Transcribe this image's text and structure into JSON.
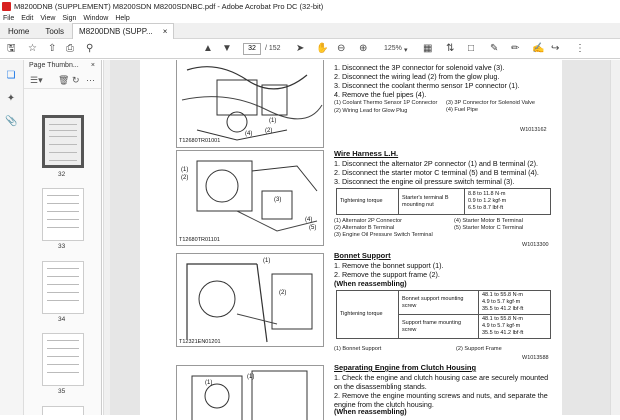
{
  "window": {
    "title": "M8200DNB (SUPPLEMENT) M8200SDN M8200SDNBC.pdf - Adobe Acrobat Pro DC (32-bit)"
  },
  "menu": [
    "File",
    "Edit",
    "View",
    "Sign",
    "Window",
    "Help"
  ],
  "tabs": [
    {
      "label": "Home"
    },
    {
      "label": "Tools"
    },
    {
      "label": "M8200DNB (SUPP...",
      "close": "×"
    }
  ],
  "toolbar": {
    "current_page": "32",
    "total_pages": "/ 152",
    "zoom": "125%"
  },
  "thumb_panel": {
    "title": "Page Thumbn...",
    "close": "×",
    "pages": [
      "32",
      "33",
      "34",
      "35"
    ]
  },
  "doc": {
    "sec0": {
      "steps": [
        "1.  Disconnect the 3P connector for solenoid valve (3).",
        "2.  Disconnect the wiring lead (2) from the glow plug.",
        "3.  Disconnect the coolant thermo sensor 1P connector (1).",
        "4.  Remove the fuel pipes (4)."
      ],
      "legend": [
        "(1)  Coolant Thermo Sensor 1P Connector",
        "(2)  Wiring Lead for Glow Plug",
        "(3)  3P Connector for Solenoid Valve",
        "(4)  Fuel Pipe"
      ],
      "code": "W1013162",
      "fig_caption": "T12680TR01001"
    },
    "sec1": {
      "heading": "Wire Harness L.H.",
      "steps": [
        "1.  Disconnect the alternator 2P connector (1) and B terminal (2).",
        "2.  Disconnect the starter motor C terminal (5) and B terminal (4).",
        "3.  Disconnect the engine oil pressure switch terminal (3)."
      ],
      "torque_label": "Tightening torque",
      "torque_item": "Starter's terminal B mounting nut",
      "torque_values": "8.8 to 11.8 N·m\n0.9 to 1.2 kgf·m\n6.5 to 8.7 lbf·ft",
      "legend": [
        "(1)  Alternator 2P Connector",
        "(2)  Alternator B Terminal",
        "(3)  Engine Oil Pressure Switch Terminal",
        "(4)  Starter Motor B Terminal",
        "(5)  Starter Motor C Terminal"
      ],
      "code": "W1013300",
      "fig_caption": "T12680TR01101"
    },
    "sec2": {
      "heading": "Bonnet Support",
      "steps": [
        "1.  Remove the bonnet support (1).",
        "2.  Remove the support frame (2)."
      ],
      "subheading": "(When reassembling)",
      "torque_label": "Tightening torque",
      "rows": [
        {
          "item": "Bonnet support mounting screw",
          "values": "48.1 to 55.8 N·m\n4.9 to 5.7 kgf·m\n35.5 to 41.2 lbf·ft"
        },
        {
          "item": "Support frame mounting screw",
          "values": "48.1 to 55.8 N·m\n4.9 to 5.7 kgf·m\n35.5 to 41.2 lbf·ft"
        }
      ],
      "legend": [
        "(1)  Bonnet Support",
        "(2)  Support Frame"
      ],
      "code": "W1013588",
      "fig_caption": "T12321EN01201"
    },
    "sec3": {
      "heading": "Separating Engine from Clutch Housing",
      "steps": [
        "1.  Check the engine and clutch housing case are securely mounted on the disassembling stands.",
        "2.  Remove the engine mounting screws and nuts, and separate the engine from the clutch housing."
      ],
      "subheading": "(When reassembling)"
    }
  }
}
